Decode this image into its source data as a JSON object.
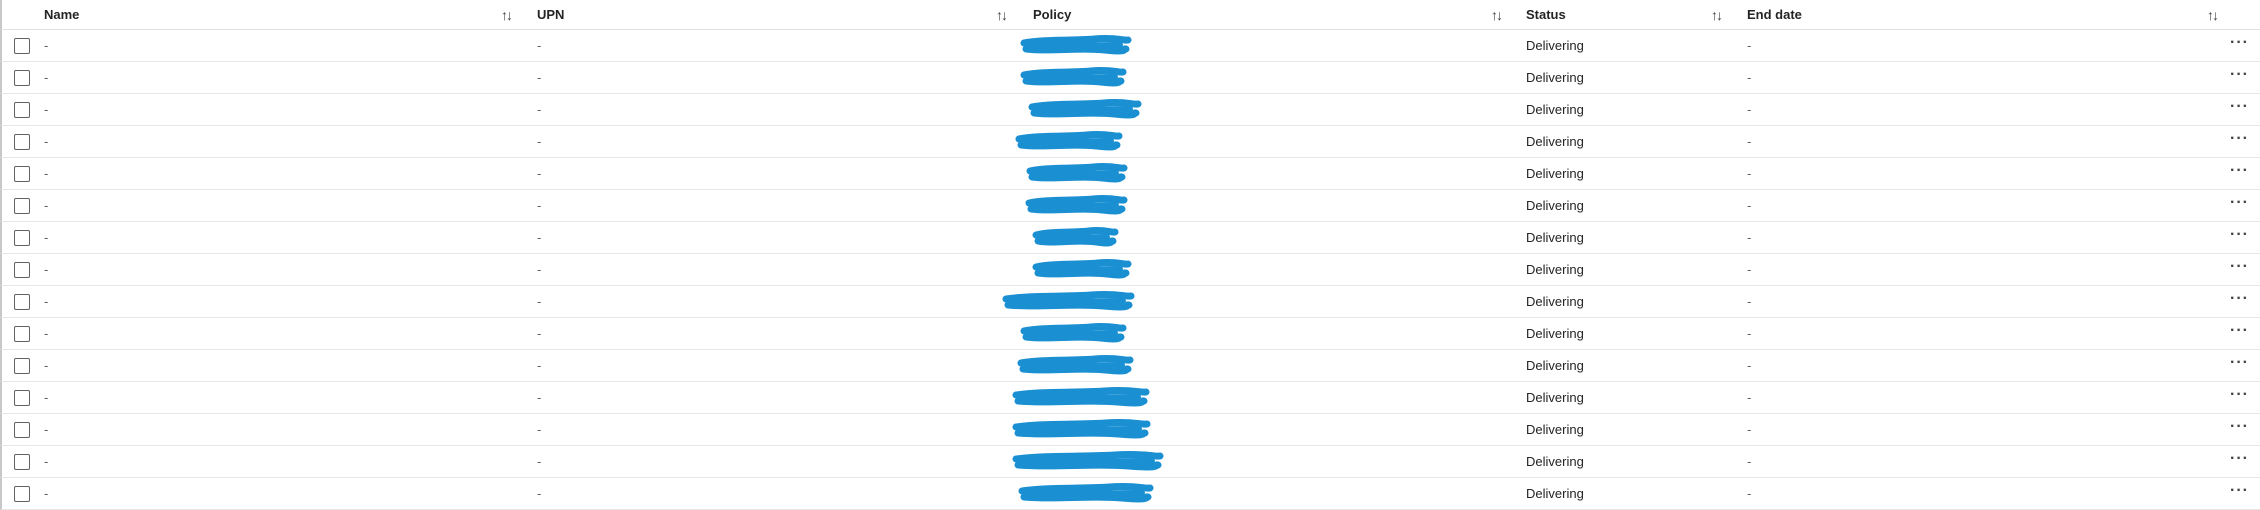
{
  "columns": {
    "name": "Name",
    "upn": "UPN",
    "policy": "Policy",
    "status": "Status",
    "end_date": "End date"
  },
  "icons": {
    "sort": "sort-arrows-icon",
    "more": "more-actions-icon",
    "checkbox": "checkbox"
  },
  "colors": {
    "redaction": "#1a8fd1"
  },
  "rows": [
    {
      "name": "-",
      "upn": "-",
      "status": "Delivering",
      "end_date": "-"
    },
    {
      "name": "-",
      "upn": "-",
      "status": "Delivering",
      "end_date": "-"
    },
    {
      "name": "-",
      "upn": "-",
      "status": "Delivering",
      "end_date": "-"
    },
    {
      "name": "-",
      "upn": "-",
      "status": "Delivering",
      "end_date": "-"
    },
    {
      "name": "-",
      "upn": "-",
      "status": "Delivering",
      "end_date": "-"
    },
    {
      "name": "-",
      "upn": "-",
      "status": "Delivering",
      "end_date": "-"
    },
    {
      "name": "-",
      "upn": "-",
      "status": "Delivering",
      "end_date": "-"
    },
    {
      "name": "-",
      "upn": "-",
      "status": "Delivering",
      "end_date": "-"
    },
    {
      "name": "-",
      "upn": "-",
      "status": "Delivering",
      "end_date": "-"
    },
    {
      "name": "-",
      "upn": "-",
      "status": "Delivering",
      "end_date": "-"
    },
    {
      "name": "-",
      "upn": "-",
      "status": "Delivering",
      "end_date": "-"
    },
    {
      "name": "-",
      "upn": "-",
      "status": "Delivering",
      "end_date": "-"
    },
    {
      "name": "-",
      "upn": "-",
      "status": "Delivering",
      "end_date": "-"
    },
    {
      "name": "-",
      "upn": "-",
      "status": "Delivering",
      "end_date": "-"
    },
    {
      "name": "-",
      "upn": "-",
      "status": "Delivering",
      "end_date": "-"
    }
  ]
}
